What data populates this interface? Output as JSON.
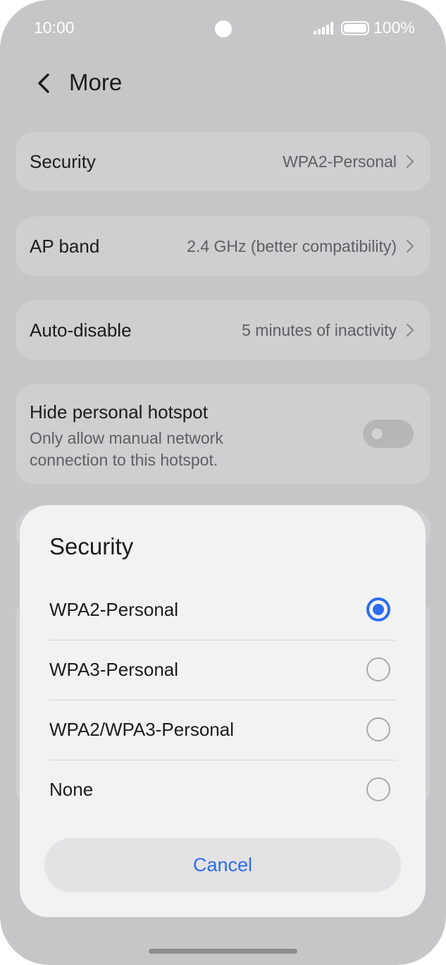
{
  "status_bar": {
    "time": "10:00",
    "battery": "100%"
  },
  "header": {
    "title": "More"
  },
  "settings": {
    "security": {
      "label": "Security",
      "value": "WPA2-Personal"
    },
    "ap_band": {
      "label": "AP band",
      "value": "2.4 GHz (better compatibility)"
    },
    "auto_disable": {
      "label": "Auto-disable",
      "value": "5 minutes of inactivity"
    },
    "hide_hotspot": {
      "label": "Hide personal hotspot",
      "description": "Only allow manual network connection to this hotspot.",
      "enabled": false
    }
  },
  "dialog": {
    "title": "Security",
    "options": [
      {
        "label": "WPA2-Personal",
        "selected": true
      },
      {
        "label": "WPA3-Personal",
        "selected": false
      },
      {
        "label": "WPA2/WPA3-Personal",
        "selected": false
      },
      {
        "label": "None",
        "selected": false
      }
    ],
    "cancel_label": "Cancel"
  },
  "colors": {
    "accent": "#2c6cf0",
    "scrim_background": "#c6c6c8",
    "sheet": "#f2f2f2"
  }
}
